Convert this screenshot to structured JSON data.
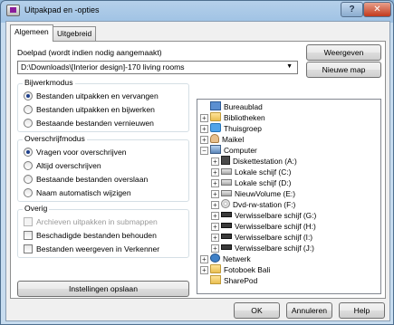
{
  "window": {
    "title": "Uitpakpad en -opties",
    "help_button": "?",
    "close_button": "✕"
  },
  "tabs": [
    {
      "label": "Algemeen",
      "active": true
    },
    {
      "label": "Uitgebreid",
      "active": false
    }
  ],
  "destination": {
    "label": "Doelpad (wordt indien nodig aangemaakt)",
    "value": "D:\\Downloads\\[Interior design]-170 living rooms",
    "show_button": "Weergeven",
    "new_folder_button": "Nieuwe map"
  },
  "update_mode": {
    "title": "Bijwerkmodus",
    "options": [
      {
        "label": "Bestanden uitpakken en vervangen",
        "selected": true
      },
      {
        "label": "Bestanden uitpakken en bijwerken",
        "selected": false
      },
      {
        "label": "Bestaande bestanden vernieuwen",
        "selected": false
      }
    ]
  },
  "overwrite_mode": {
    "title": "Overschrijfmodus",
    "options": [
      {
        "label": "Vragen voor overschrijven",
        "selected": true
      },
      {
        "label": "Altijd overschrijven",
        "selected": false
      },
      {
        "label": "Bestaande bestanden overslaan",
        "selected": false
      },
      {
        "label": "Naam automatisch wijzigen",
        "selected": false
      }
    ]
  },
  "misc": {
    "title": "Overig",
    "options": [
      {
        "label": "Archieven uitpakken in submappen",
        "checked": false,
        "disabled": true
      },
      {
        "label": "Beschadigde bestanden behouden",
        "checked": false,
        "disabled": false
      },
      {
        "label": "Bestanden weergeven in Verkenner",
        "checked": false,
        "disabled": false
      }
    ]
  },
  "save_settings_button": "Instellingen opslaan",
  "tree": [
    {
      "label": "Bureaublad",
      "icon": "desktop-icon",
      "expander": ""
    },
    {
      "label": "Bibliotheken",
      "icon": "folder-icon",
      "expander": "+"
    },
    {
      "label": "Thuisgroep",
      "icon": "homegroup-icon",
      "expander": "+"
    },
    {
      "label": "Maikel",
      "icon": "user-icon",
      "expander": "+"
    },
    {
      "label": "Computer",
      "icon": "computer-icon",
      "expander": "−"
    },
    {
      "label": "Diskettestation (A:)",
      "icon": "floppy-icon",
      "expander": "+"
    },
    {
      "label": "Lokale schijf (C:)",
      "icon": "drive-icon",
      "expander": "+"
    },
    {
      "label": "Lokale schijf (D:)",
      "icon": "drive-icon",
      "expander": "+"
    },
    {
      "label": "NieuwVolume (E:)",
      "icon": "drive-icon",
      "expander": "+"
    },
    {
      "label": "Dvd-rw-station (F:)",
      "icon": "dvd-icon",
      "expander": "+"
    },
    {
      "label": "Verwisselbare schijf (G:)",
      "icon": "removable-drive-icon",
      "expander": "+"
    },
    {
      "label": "Verwisselbare schijf (H:)",
      "icon": "removable-drive-icon",
      "expander": "+"
    },
    {
      "label": "Verwisselbare schijf (I:)",
      "icon": "removable-drive-icon",
      "expander": "+"
    },
    {
      "label": "Verwisselbare schijf (J:)",
      "icon": "removable-drive-icon",
      "expander": "+"
    },
    {
      "label": "Netwerk",
      "icon": "network-icon",
      "expander": "+"
    },
    {
      "label": "Fotoboek Bali",
      "icon": "folder-icon",
      "expander": "+"
    },
    {
      "label": "SharePod",
      "icon": "folder-icon",
      "expander": ""
    }
  ],
  "footer": {
    "ok_button": "OK",
    "cancel_button": "Annuleren",
    "help_button": "Help"
  }
}
